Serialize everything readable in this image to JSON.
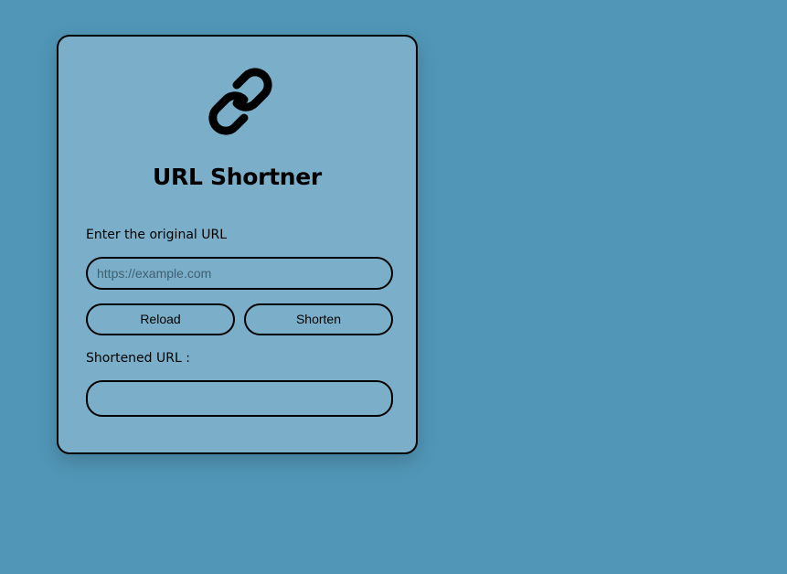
{
  "app": {
    "title": "URL Shortner",
    "logo_icon": "link-icon"
  },
  "form": {
    "original_label": "Enter the original URL",
    "input_placeholder": "https://example.com",
    "input_value": "",
    "reload_label": "Reload",
    "shorten_label": "Shorten",
    "result_label": "Shortened URL :",
    "result_value": ""
  },
  "colors": {
    "page_background": "#5196b7",
    "card_background": "#7bafc9",
    "border": "#000000"
  }
}
